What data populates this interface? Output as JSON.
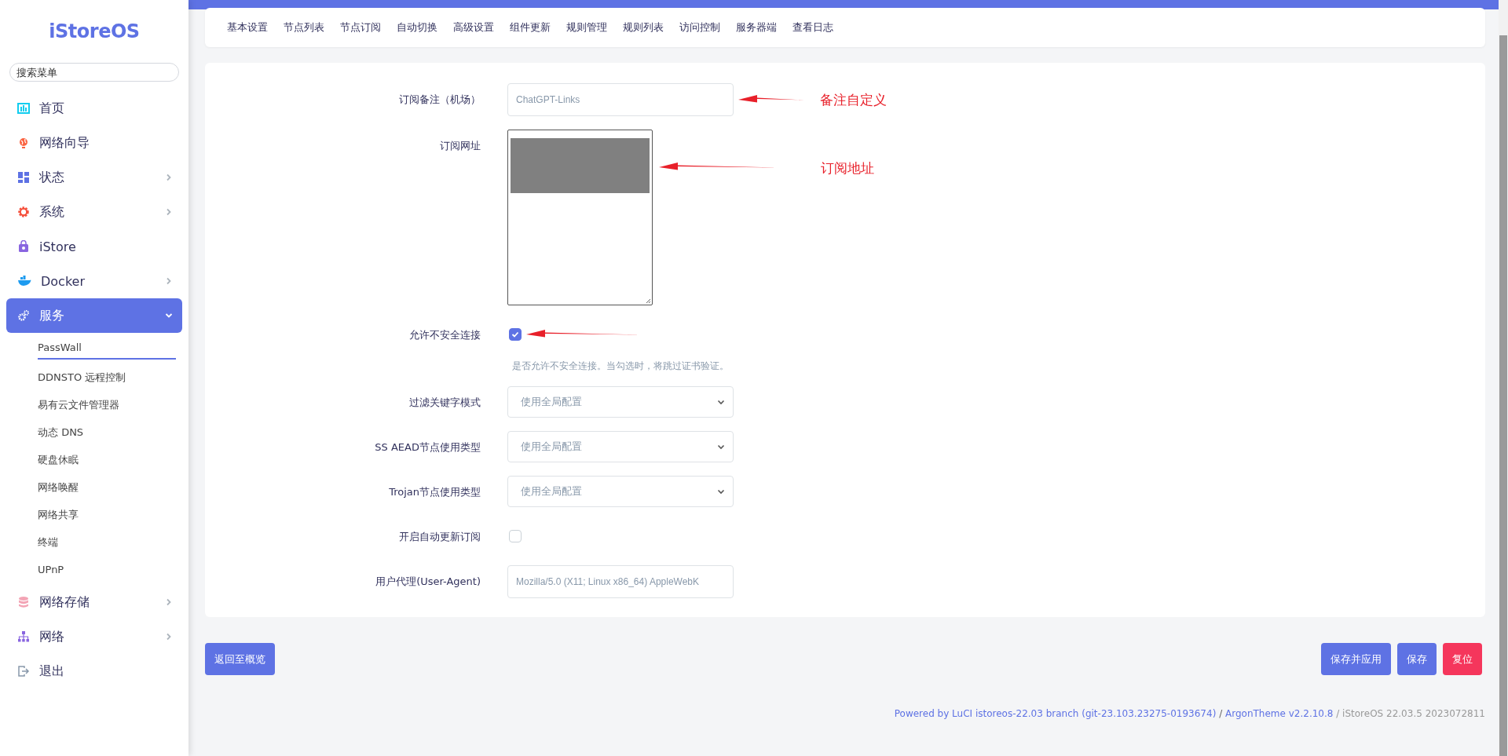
{
  "logo": "iStoreOS",
  "search": {
    "placeholder": "搜索菜单"
  },
  "menu": [
    {
      "label": "首页",
      "kind": "link",
      "selected": false
    },
    {
      "label": "网络向导",
      "kind": "link",
      "selected": false
    },
    {
      "label": "状态",
      "kind": "group",
      "expanded": false,
      "selected": false
    },
    {
      "label": "系统",
      "kind": "group",
      "expanded": false,
      "selected": false
    },
    {
      "label": "iStore",
      "kind": "link",
      "selected": false
    },
    {
      "label": "Docker",
      "kind": "group",
      "expanded": false,
      "selected": false
    },
    {
      "label": "服务",
      "kind": "group",
      "expanded": true,
      "selected": true,
      "children": [
        {
          "label": "PassWall",
          "selected": true
        },
        {
          "label": "DDNSTO 远程控制",
          "selected": false
        },
        {
          "label": "易有云文件管理器",
          "selected": false
        },
        {
          "label": "动态 DNS",
          "selected": false
        },
        {
          "label": "硬盘休眠",
          "selected": false
        },
        {
          "label": "网络唤醒",
          "selected": false
        },
        {
          "label": "网络共享",
          "selected": false
        },
        {
          "label": "终端",
          "selected": false
        },
        {
          "label": "UPnP",
          "selected": false
        }
      ]
    },
    {
      "label": "网络存储",
      "kind": "group",
      "expanded": false,
      "selected": false
    },
    {
      "label": "网络",
      "kind": "group",
      "expanded": false,
      "selected": false
    },
    {
      "label": "退出",
      "kind": "link",
      "selected": false
    }
  ],
  "tabs": [
    {
      "label": "基本设置",
      "selected": false
    },
    {
      "label": "节点列表",
      "selected": false
    },
    {
      "label": "节点订阅",
      "selected": false
    },
    {
      "label": "自动切换",
      "selected": false
    },
    {
      "label": "高级设置",
      "selected": false
    },
    {
      "label": "组件更新",
      "selected": false
    },
    {
      "label": "规则管理",
      "selected": false
    },
    {
      "label": "规则列表",
      "selected": false
    },
    {
      "label": "访问控制",
      "selected": false
    },
    {
      "label": "服务器端",
      "selected": false
    },
    {
      "label": "查看日志",
      "selected": false
    }
  ],
  "form": [
    {
      "kind": "text",
      "label": "订阅备注（机场）",
      "placeholder": "ChatGPT-Links",
      "arrow": true,
      "note": "备注自定义"
    },
    {
      "kind": "textarea",
      "label": "订阅网址",
      "arrow": true,
      "note": "订阅地址"
    },
    {
      "kind": "checkbox",
      "label": "允许不安全连接",
      "checked": true,
      "arrow": true,
      "description": "是否允许不安全连接。当勾选时，将跳过证书验证。"
    },
    {
      "kind": "select",
      "label": "过滤关键字模式",
      "value": "使用全局配置",
      "arrow": false
    },
    {
      "kind": "select",
      "label": "SS AEAD节点使用类型",
      "value": "使用全局配置",
      "arrow": false
    },
    {
      "kind": "select",
      "label": "Trojan节点使用类型",
      "value": "使用全局配置",
      "arrow": false
    },
    {
      "kind": "checkbox",
      "label": "开启自动更新订阅",
      "checked": false,
      "arrow": false
    },
    {
      "kind": "text",
      "label": "用户代理(User-Agent)",
      "placeholder": "Mozilla/5.0 (X11; Linux x86_64) AppleWebK",
      "arrow": false
    }
  ],
  "back_button": "返回至概览",
  "actions": [
    {
      "label": "保存并应用",
      "kind": "primary"
    },
    {
      "label": "保存",
      "kind": "primary"
    },
    {
      "label": "复位",
      "kind": "danger"
    }
  ],
  "footer": [
    {
      "text": "Powered by LuCI istoreos-22.03 branch (git-23.103.23275-0193674)",
      "kind": "link"
    },
    {
      "text": " / ",
      "kind": "separator"
    },
    {
      "text": "ArgonTheme v2.2.10.8",
      "kind": "link"
    },
    {
      "text": " / iStoreOS 22.03.5 2023072811",
      "kind": "text"
    }
  ]
}
